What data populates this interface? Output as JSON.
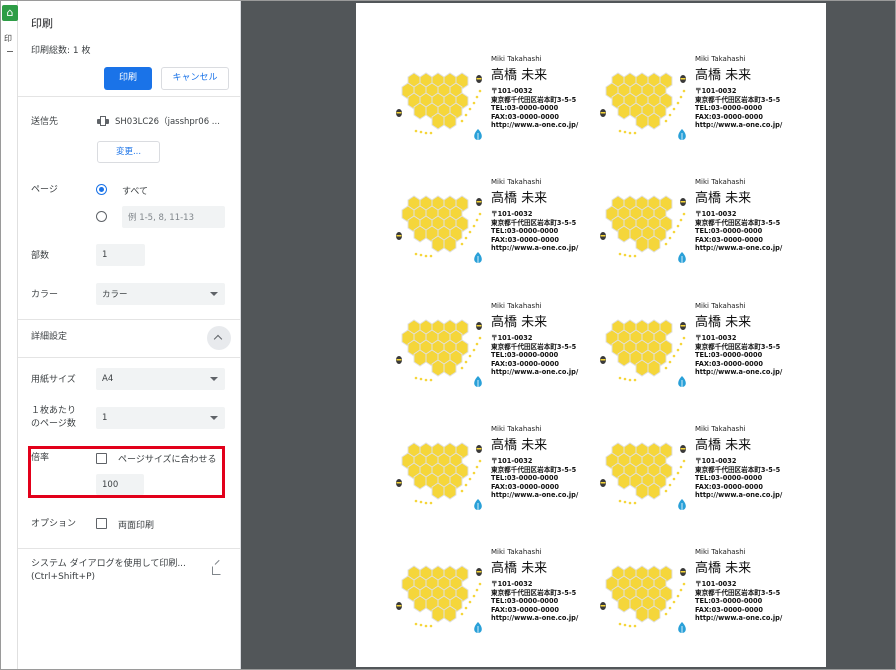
{
  "background": {
    "tab_label": "印"
  },
  "dialog": {
    "title": "印刷",
    "sheet_count": "印刷総数: 1 枚",
    "print_button": "印刷",
    "cancel_button": "キャンセル",
    "destination": {
      "label": "送信先",
      "printer": "SH03LC26（jasshpr06 ...",
      "change_button": "変更..."
    },
    "pages": {
      "label": "ページ",
      "all_label": "すべて",
      "custom_placeholder": "例 1-5, 8, 11-13"
    },
    "copies": {
      "label": "部数",
      "value": "1"
    },
    "color": {
      "label": "カラー",
      "value": "カラー"
    },
    "advanced": {
      "label": "詳細設定"
    },
    "paper_size": {
      "label": "用紙サイズ",
      "value": "A4"
    },
    "pages_per_sheet": {
      "label_line1": "１枚あたり",
      "label_line2": "のページ数",
      "value": "1"
    },
    "scale": {
      "label": "倍率",
      "fit_label": "ページサイズに合わせる",
      "value": "100"
    },
    "options": {
      "label": "オプション",
      "duplex_label": "両面印刷"
    },
    "system_dialog": {
      "line1": "システム ダイアログを使用して印刷...",
      "line2": "(Ctrl+Shift+P)"
    }
  },
  "card": {
    "name_en": "Miki Takahashi",
    "name_jp": "高橋 未来",
    "postal": "〒101-0032",
    "address": "東京都千代田区岩本町3-5-5",
    "tel": "TEL:03-0000-0000",
    "fax": "FAX:03-0000-0000",
    "url": "http://www.a-one.co.jp/"
  },
  "colors": {
    "accent": "#1a73e8",
    "highlight": "#e2001a",
    "honey": "#f5d63a",
    "leaf": "#29a0d8",
    "preview_bg": "#525659"
  }
}
